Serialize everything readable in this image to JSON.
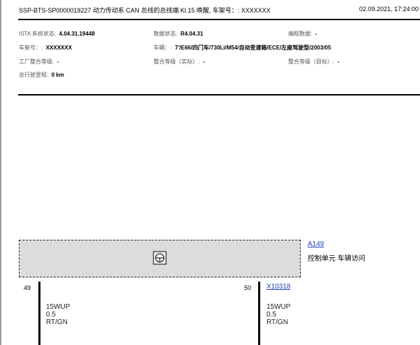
{
  "header": {
    "doc_id": "SSP-BTS-SP0000019227",
    "doc_title": "动力传动系 CAN 总线的总线端 Kl.15 唤醒, 车架号：: XXXXXXX",
    "datetime": "02.09.2021, 17:24:00"
  },
  "info": {
    "ista_label": "ISTA 系统状态:",
    "ista_value": "4.04.31.19448",
    "data_label": "数据状态:",
    "data_value": "R4.04.31",
    "prog_label": "编程数据:",
    "prog_value": "-",
    "vin_label": "车架号：:",
    "vin_value": "XXXXXXX",
    "vehicle_label": "车辆：:",
    "vehicle_value": "7'/E66/四门车/730Li/M54/自动变速箱/ECE/左座驾驶型/2003/05",
    "factory_label": "工厂整合等级:",
    "factory_value": "-",
    "actual_label": "整合等级（实际）:",
    "actual_value": "-",
    "target_label": "整合等级（目标）:",
    "target_value": "-",
    "mileage_label": "总行驶里程:",
    "mileage_value": "0 km"
  },
  "diagram": {
    "component_id": "A149",
    "component_name": "控制单元 车辆访问",
    "connector_id": "X10318",
    "pin_left": "49",
    "pin_right": "50",
    "wire_left": {
      "name": "15WUP",
      "cross_section": "0.5",
      "color": "RT/GN"
    },
    "wire_right": {
      "name": "15WUP",
      "cross_section": "0.5",
      "color": "RT/GN"
    }
  },
  "colors": {
    "link": "#1a3fb5",
    "component_fill": "#dcdcdc"
  }
}
